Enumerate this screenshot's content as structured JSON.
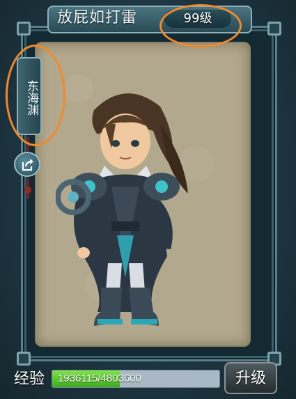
{
  "character": {
    "name": "放屁如打雷",
    "level": "99级"
  },
  "side_tab": {
    "label": "东海渊"
  },
  "share": {
    "icon": "share-icon"
  },
  "experience": {
    "label": "经验",
    "text": "1936115/4803600",
    "current": 1936115,
    "max": 4803600,
    "fraction": 0.403
  },
  "upgrade_button": {
    "label": "升级"
  },
  "colors": {
    "annotation": "#f08a2c",
    "xp_fill": "#4fc42a",
    "panel": "#b2a88d"
  }
}
